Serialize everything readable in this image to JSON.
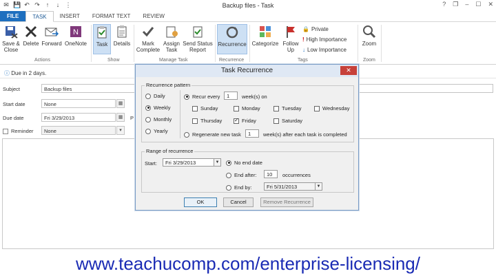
{
  "window": {
    "title": "Backup files - Task",
    "controls": [
      "?",
      "❐",
      "–",
      "☐",
      "✕"
    ]
  },
  "tabs": [
    {
      "label": "FILE"
    },
    {
      "label": "TASK"
    },
    {
      "label": "INSERT"
    },
    {
      "label": "FORMAT TEXT"
    },
    {
      "label": "REVIEW"
    }
  ],
  "ribbon": {
    "actions": {
      "save_close": "Save &\nClose",
      "delete": "Delete",
      "forward": "Forward",
      "onenote": "OneNote",
      "group": "Actions"
    },
    "show": {
      "task": "Task",
      "details": "Details",
      "group": "Show"
    },
    "manage": {
      "mark_complete": "Mark\nComplete",
      "assign_task": "Assign\nTask",
      "send_status": "Send Status\nReport",
      "group": "Manage Task"
    },
    "recurrence": {
      "label": "Recurrence",
      "group": "Recurrence"
    },
    "tags": {
      "categorize": "Categorize",
      "follow_up": "Follow\nUp",
      "private": "Private",
      "high": "High Importance",
      "low": "Low Importance",
      "group": "Tags"
    },
    "zoom": {
      "label": "Zoom",
      "group": "Zoom"
    }
  },
  "form": {
    "info": "Due in 2 days.",
    "subject_label": "Subject",
    "subject_value": "Backup files",
    "start_label": "Start date",
    "start_value": "None",
    "due_label": "Due date",
    "due_value": "Fri 3/29/2013",
    "reminder_label": "Reminder",
    "reminder_value": "None",
    "priority_fragment": "P"
  },
  "dialog": {
    "title": "Task Recurrence",
    "pattern_legend": "Recurrence pattern",
    "frequencies": [
      {
        "label": "Daily",
        "selected": false
      },
      {
        "label": "Weekly",
        "selected": true
      },
      {
        "label": "Monthly",
        "selected": false
      },
      {
        "label": "Yearly",
        "selected": false
      }
    ],
    "recur_every_label": "Recur every",
    "recur_every_value": "1",
    "weeks_on_label": "week(s) on",
    "days": [
      {
        "label": "Sunday",
        "checked": false
      },
      {
        "label": "Monday",
        "checked": false
      },
      {
        "label": "Tuesday",
        "checked": false
      },
      {
        "label": "Wednesday",
        "checked": false
      },
      {
        "label": "Thursday",
        "checked": false
      },
      {
        "label": "Friday",
        "checked": true
      },
      {
        "label": "Saturday",
        "checked": false
      }
    ],
    "regenerate_label": "Regenerate new task",
    "regenerate_value": "1",
    "regenerate_suffix": "week(s) after each task is completed",
    "range_legend": "Range of recurrence",
    "start_label": "Start:",
    "start_value": "Fri 3/29/2013",
    "no_end_label": "No end date",
    "end_after_label": "End after:",
    "end_after_value": "10",
    "occurrences_label": "occurrences",
    "end_by_label": "End by:",
    "end_by_value": "Fri 5/31/2013",
    "ok": "OK",
    "cancel": "Cancel",
    "remove": "Remove Recurrence"
  },
  "watermark": "www.teachucomp.com/enterprise-licensing/"
}
